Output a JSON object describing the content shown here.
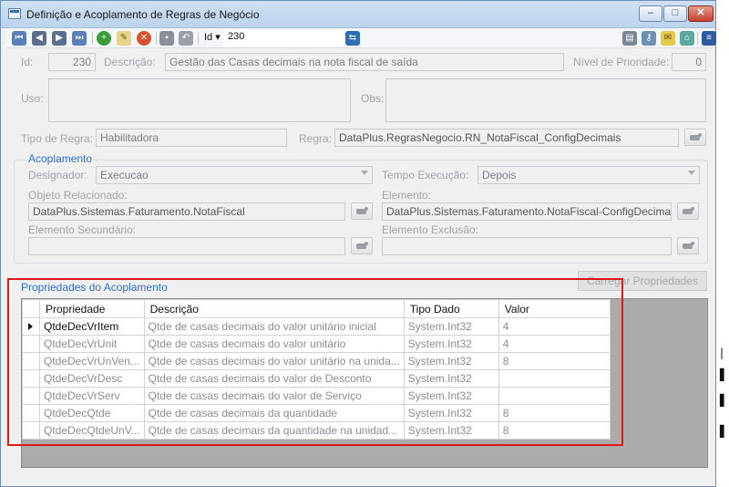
{
  "window": {
    "title": "Definição e Acoplamento de Regras de Negócio",
    "controls": {
      "minimize": "–",
      "maximize": "□",
      "close": "✕"
    }
  },
  "toolbar": {
    "id_label": "Id",
    "id_value": "230",
    "icons": [
      "first-record-icon",
      "prev-record-icon",
      "next-record-icon",
      "last-record-icon",
      "add-icon",
      "edit-icon",
      "delete-icon",
      "save-icon",
      "undo-icon",
      "id-dropdown-icon",
      "search-go-icon",
      "print-icon",
      "key-icon",
      "note-icon",
      "pin-icon",
      "menu-icon"
    ]
  },
  "form": {
    "id_label": "Id:",
    "id_value": "230",
    "descricao_label": "Descrição:",
    "descricao_value": "Gestão das Casas decimais na nota fiscal de saída",
    "prioridade_label": "Nível de Prioridade:",
    "prioridade_value": "0",
    "uso_label": "Uso:",
    "obs_label": "Obs:",
    "tipo_regra_label": "Tipo de Regra:",
    "tipo_regra_value": "Habilitadora",
    "regra_label": "Regra:",
    "regra_value": "DataPlus.RegrasNegocio.RN_NotaFiscal_ConfigDecimais"
  },
  "acoplamento": {
    "title": "Acoplamento",
    "designador_label": "Designador:",
    "designador_value": "Execucao",
    "tempo_label": "Tempo Execução:",
    "tempo_value": "Depois",
    "objeto_label": "Objeto Relacionado:",
    "objeto_value": "DataPlus.Sistemas.Faturamento.NotaFiscal",
    "elemento_label": "Elemento:",
    "elemento_value": "DataPlus.Sistemas.Faturamento.NotaFiscal-ConfigDecimais",
    "elem_secundario_label": "Elemento Secundário:",
    "elem_exclusao_label": "Elemento Exclusão:"
  },
  "propriedades": {
    "title": "Propriedades do Acoplamento",
    "carregar_button": "Carregar Propriedades",
    "columns": [
      "Propriedade",
      "Descrição",
      "Tipo Dado",
      "Valor"
    ],
    "rows": [
      {
        "propriedade": "QtdeDecVrItem",
        "descricao": "Qtde de casas decimais do valor unitário inicial",
        "tipo": "System.Int32",
        "valor": "4"
      },
      {
        "propriedade": "QtdeDecVrUnit",
        "descricao": "Qtde de casas decimais do valor unitário",
        "tipo": "System.Int32",
        "valor": "4"
      },
      {
        "propriedade": "QtdeDecVrUnVen...",
        "descricao": "Qtde de casas decimais do valor unitário na unida...",
        "tipo": "System.Int32",
        "valor": "8"
      },
      {
        "propriedade": "QtdeDecVrDesc",
        "descricao": "Qtde de casas decimais do valor de Desconto",
        "tipo": "System.Int32",
        "valor": ""
      },
      {
        "propriedade": "QtdeDecVrServ",
        "descricao": "Qtde de casas decimais do valor de Serviço",
        "tipo": "System.Int32",
        "valor": ""
      },
      {
        "propriedade": "QtdeDecQtde",
        "descricao": "Qtde de casas decimais da quantidade",
        "tipo": "System.Int32",
        "valor": "8"
      },
      {
        "propriedade": "QtdeDecQtdeUnV...",
        "descricao": "Qtde de casas decimais da quantidade na unidad...",
        "tipo": "System.Int32",
        "valor": "8"
      }
    ],
    "selected_row": 0
  },
  "colors": {
    "highlight_box": "#e01818",
    "group_title": "#2f6fd0",
    "grid_background": "#ababab"
  }
}
